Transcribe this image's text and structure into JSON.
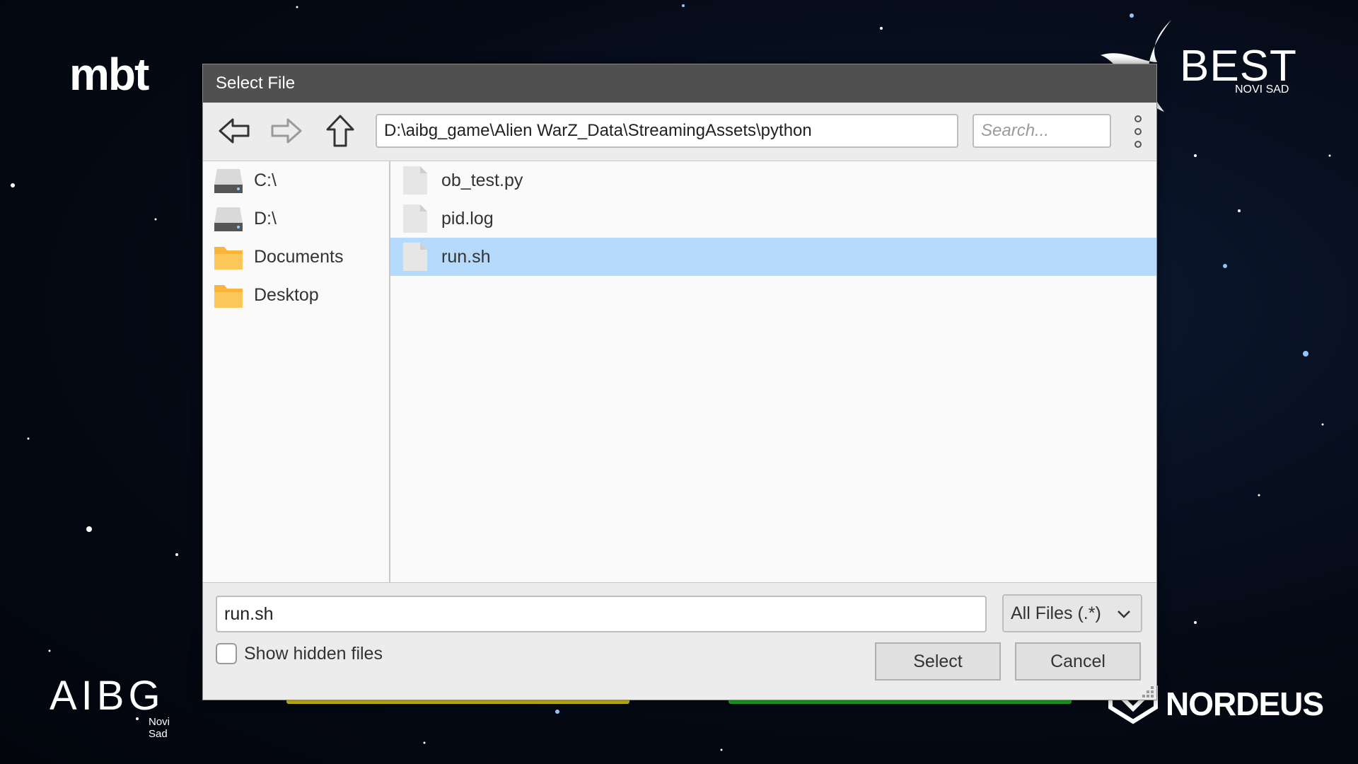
{
  "background": {
    "logos": {
      "mbt": "mbt",
      "best": "BEST",
      "best_sub": "NOVI SAD",
      "aibg": "AIBG",
      "aibg_sub": "Novi Sad",
      "nordeus": "NORDEUS"
    },
    "colors": {
      "yellow_bar": "#d4c21a",
      "green_bar": "#1fa82a"
    }
  },
  "dialog": {
    "title": "Select File",
    "toolbar": {
      "back_icon": "arrow-left-icon",
      "forward_icon": "arrow-right-icon",
      "up_icon": "arrow-up-icon",
      "path": "D:\\aibg_game\\Alien WarZ_Data\\StreamingAssets\\python",
      "search_placeholder": "Search...",
      "more_icon": "more-vertical-icon"
    },
    "sidebar": {
      "items": [
        {
          "label": "C:\\",
          "icon": "drive-icon"
        },
        {
          "label": "D:\\",
          "icon": "drive-icon"
        },
        {
          "label": "Documents",
          "icon": "folder-icon"
        },
        {
          "label": "Desktop",
          "icon": "folder-icon"
        }
      ]
    },
    "files": [
      {
        "name": "ob_test.py",
        "icon": "file-icon",
        "selected": false
      },
      {
        "name": "pid.log",
        "icon": "file-icon",
        "selected": false
      },
      {
        "name": "run.sh",
        "icon": "file-icon",
        "selected": true
      }
    ],
    "filename_value": "run.sh",
    "filter_selected": "All Files (.*)",
    "show_hidden_label": "Show hidden files",
    "show_hidden_checked": false,
    "select_label": "Select",
    "cancel_label": "Cancel",
    "colors": {
      "titlebar": "#505050",
      "selection": "#b5dafb",
      "folder": "#f8b53a"
    }
  }
}
